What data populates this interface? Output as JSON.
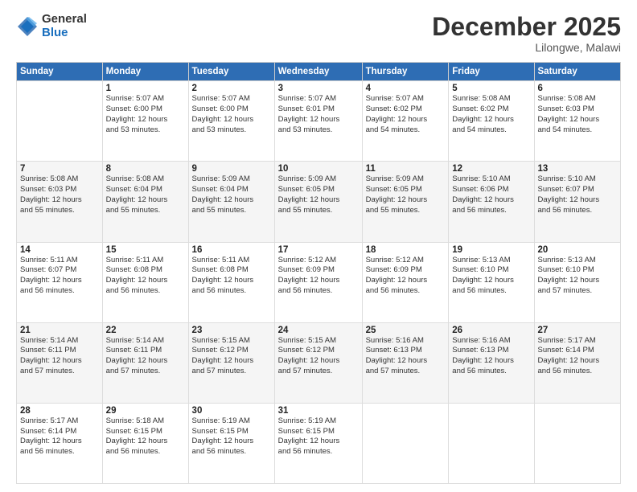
{
  "logo": {
    "general": "General",
    "blue": "Blue"
  },
  "header": {
    "month": "December 2025",
    "location": "Lilongwe, Malawi"
  },
  "weekdays": [
    "Sunday",
    "Monday",
    "Tuesday",
    "Wednesday",
    "Thursday",
    "Friday",
    "Saturday"
  ],
  "weeks": [
    [
      {
        "day": "",
        "info": ""
      },
      {
        "day": "1",
        "info": "Sunrise: 5:07 AM\nSunset: 6:00 PM\nDaylight: 12 hours\nand 53 minutes."
      },
      {
        "day": "2",
        "info": "Sunrise: 5:07 AM\nSunset: 6:00 PM\nDaylight: 12 hours\nand 53 minutes."
      },
      {
        "day": "3",
        "info": "Sunrise: 5:07 AM\nSunset: 6:01 PM\nDaylight: 12 hours\nand 53 minutes."
      },
      {
        "day": "4",
        "info": "Sunrise: 5:07 AM\nSunset: 6:02 PM\nDaylight: 12 hours\nand 54 minutes."
      },
      {
        "day": "5",
        "info": "Sunrise: 5:08 AM\nSunset: 6:02 PM\nDaylight: 12 hours\nand 54 minutes."
      },
      {
        "day": "6",
        "info": "Sunrise: 5:08 AM\nSunset: 6:03 PM\nDaylight: 12 hours\nand 54 minutes."
      }
    ],
    [
      {
        "day": "7",
        "info": "Sunrise: 5:08 AM\nSunset: 6:03 PM\nDaylight: 12 hours\nand 55 minutes."
      },
      {
        "day": "8",
        "info": "Sunrise: 5:08 AM\nSunset: 6:04 PM\nDaylight: 12 hours\nand 55 minutes."
      },
      {
        "day": "9",
        "info": "Sunrise: 5:09 AM\nSunset: 6:04 PM\nDaylight: 12 hours\nand 55 minutes."
      },
      {
        "day": "10",
        "info": "Sunrise: 5:09 AM\nSunset: 6:05 PM\nDaylight: 12 hours\nand 55 minutes."
      },
      {
        "day": "11",
        "info": "Sunrise: 5:09 AM\nSunset: 6:05 PM\nDaylight: 12 hours\nand 55 minutes."
      },
      {
        "day": "12",
        "info": "Sunrise: 5:10 AM\nSunset: 6:06 PM\nDaylight: 12 hours\nand 56 minutes."
      },
      {
        "day": "13",
        "info": "Sunrise: 5:10 AM\nSunset: 6:07 PM\nDaylight: 12 hours\nand 56 minutes."
      }
    ],
    [
      {
        "day": "14",
        "info": "Sunrise: 5:11 AM\nSunset: 6:07 PM\nDaylight: 12 hours\nand 56 minutes."
      },
      {
        "day": "15",
        "info": "Sunrise: 5:11 AM\nSunset: 6:08 PM\nDaylight: 12 hours\nand 56 minutes."
      },
      {
        "day": "16",
        "info": "Sunrise: 5:11 AM\nSunset: 6:08 PM\nDaylight: 12 hours\nand 56 minutes."
      },
      {
        "day": "17",
        "info": "Sunrise: 5:12 AM\nSunset: 6:09 PM\nDaylight: 12 hours\nand 56 minutes."
      },
      {
        "day": "18",
        "info": "Sunrise: 5:12 AM\nSunset: 6:09 PM\nDaylight: 12 hours\nand 56 minutes."
      },
      {
        "day": "19",
        "info": "Sunrise: 5:13 AM\nSunset: 6:10 PM\nDaylight: 12 hours\nand 56 minutes."
      },
      {
        "day": "20",
        "info": "Sunrise: 5:13 AM\nSunset: 6:10 PM\nDaylight: 12 hours\nand 57 minutes."
      }
    ],
    [
      {
        "day": "21",
        "info": "Sunrise: 5:14 AM\nSunset: 6:11 PM\nDaylight: 12 hours\nand 57 minutes."
      },
      {
        "day": "22",
        "info": "Sunrise: 5:14 AM\nSunset: 6:11 PM\nDaylight: 12 hours\nand 57 minutes."
      },
      {
        "day": "23",
        "info": "Sunrise: 5:15 AM\nSunset: 6:12 PM\nDaylight: 12 hours\nand 57 minutes."
      },
      {
        "day": "24",
        "info": "Sunrise: 5:15 AM\nSunset: 6:12 PM\nDaylight: 12 hours\nand 57 minutes."
      },
      {
        "day": "25",
        "info": "Sunrise: 5:16 AM\nSunset: 6:13 PM\nDaylight: 12 hours\nand 57 minutes."
      },
      {
        "day": "26",
        "info": "Sunrise: 5:16 AM\nSunset: 6:13 PM\nDaylight: 12 hours\nand 56 minutes."
      },
      {
        "day": "27",
        "info": "Sunrise: 5:17 AM\nSunset: 6:14 PM\nDaylight: 12 hours\nand 56 minutes."
      }
    ],
    [
      {
        "day": "28",
        "info": "Sunrise: 5:17 AM\nSunset: 6:14 PM\nDaylight: 12 hours\nand 56 minutes."
      },
      {
        "day": "29",
        "info": "Sunrise: 5:18 AM\nSunset: 6:15 PM\nDaylight: 12 hours\nand 56 minutes."
      },
      {
        "day": "30",
        "info": "Sunrise: 5:19 AM\nSunset: 6:15 PM\nDaylight: 12 hours\nand 56 minutes."
      },
      {
        "day": "31",
        "info": "Sunrise: 5:19 AM\nSunset: 6:15 PM\nDaylight: 12 hours\nand 56 minutes."
      },
      {
        "day": "",
        "info": ""
      },
      {
        "day": "",
        "info": ""
      },
      {
        "day": "",
        "info": ""
      }
    ]
  ]
}
